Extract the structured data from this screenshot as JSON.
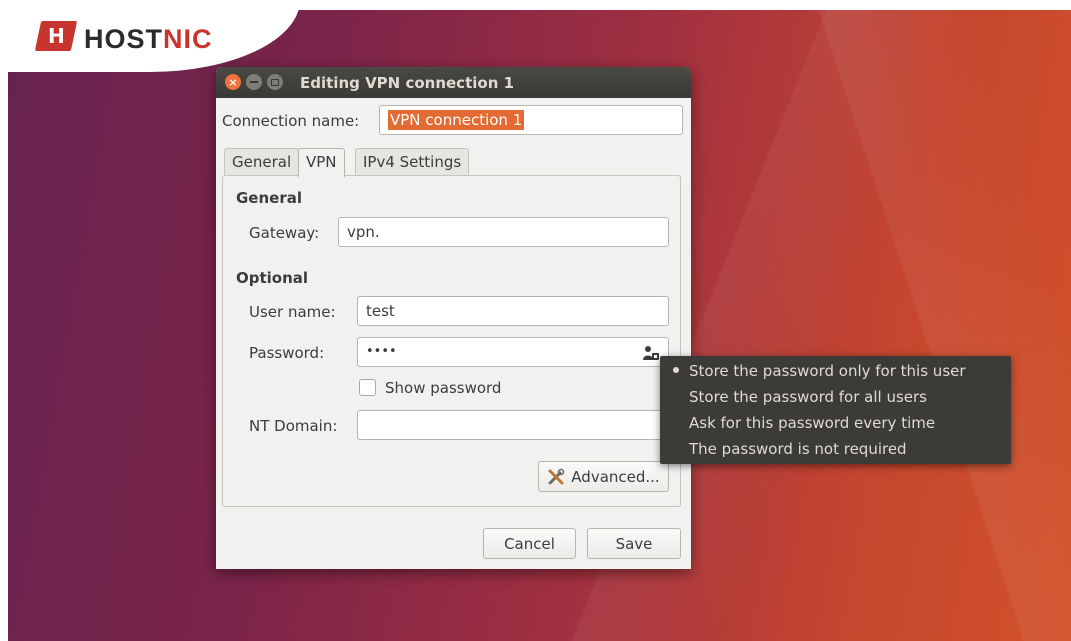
{
  "brand": {
    "logo_prefix": "HOST",
    "logo_suffix": "NIC",
    "brand_color": "#c8342e"
  },
  "window": {
    "title": "Editing VPN connection 1",
    "accent": "#e46a33"
  },
  "connection": {
    "label": "Connection name:",
    "value": "VPN connection 1"
  },
  "tabs": [
    {
      "label": "General"
    },
    {
      "label": "VPN"
    },
    {
      "label": "IPv4 Settings"
    }
  ],
  "general": {
    "heading": "General",
    "gateway_label": "Gateway:",
    "gateway_value": "vpn."
  },
  "optional": {
    "heading": "Optional",
    "username_label": "User name:",
    "username_value": "test",
    "password_label": "Password:",
    "password_value": "••••",
    "password_icon": "user-lock-icon",
    "show_password_label": "Show password",
    "show_password_checked": false,
    "ntdomain_label": "NT Domain:",
    "ntdomain_value": ""
  },
  "buttons": {
    "advanced": "Advanced...",
    "advanced_icon": "tools-icon",
    "cancel": "Cancel",
    "save": "Save"
  },
  "password_menu": {
    "items": [
      {
        "label": "Store the password only for this user",
        "selected": true
      },
      {
        "label": "Store the password for all users",
        "selected": false
      },
      {
        "label": "Ask for this password every time",
        "selected": false
      },
      {
        "label": "The password is not required",
        "selected": false
      }
    ]
  }
}
